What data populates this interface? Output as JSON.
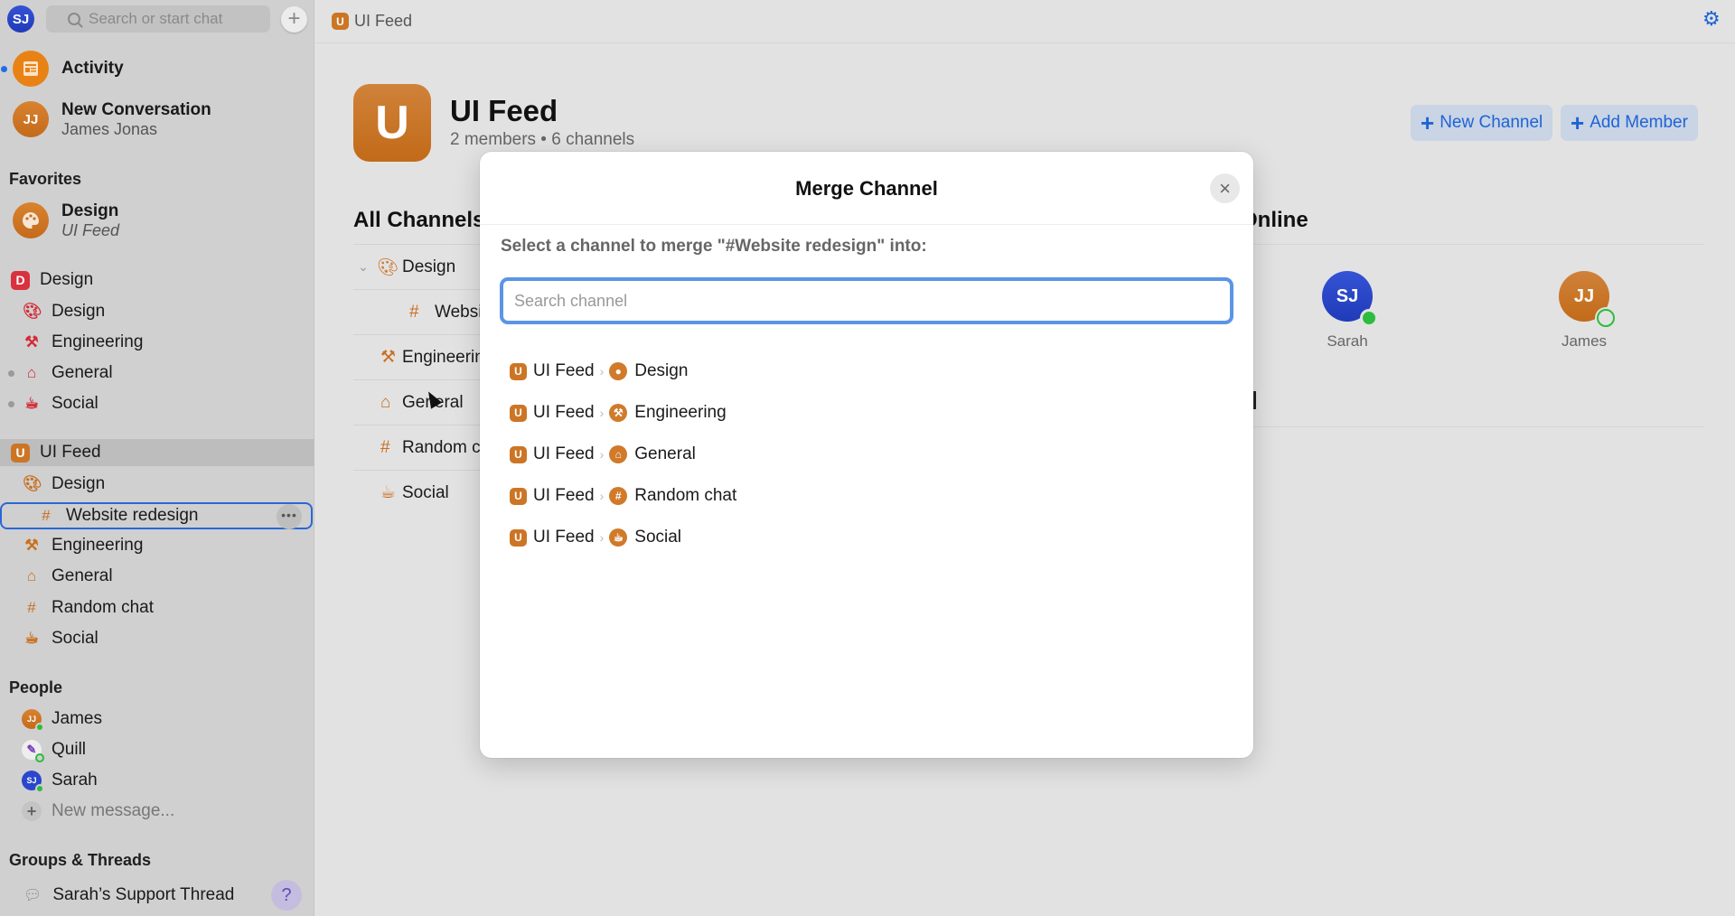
{
  "sidebar": {
    "me_initials": "SJ",
    "search_placeholder": "Search or start chat",
    "new_chat_icon": "plus-icon",
    "activity": {
      "label": "Activity",
      "icon": "newspaper-icon",
      "unread": true
    },
    "conversation": {
      "title": "New Conversation",
      "subtitle": "James Jonas",
      "initials": "JJ"
    },
    "favorites": {
      "heading": "Favorites",
      "items": [
        {
          "title": "Design",
          "subtitle": "UI Feed",
          "icon": "palette-icon"
        }
      ]
    },
    "workspaces": [
      {
        "badge": "D",
        "name": "Design",
        "color": "#d8313f",
        "channels": [
          {
            "label": "Design",
            "icon": "palette-icon",
            "unread": false
          },
          {
            "label": "Engineering",
            "icon": "hammer-icon",
            "unread": false
          },
          {
            "label": "General",
            "icon": "house-icon",
            "unread": true
          },
          {
            "label": "Social",
            "icon": "cup-icon",
            "unread": true
          }
        ]
      },
      {
        "badge": "U",
        "name": "UI Feed",
        "color": "#cc7525",
        "channels": [
          {
            "label": "Design",
            "icon": "palette-icon"
          },
          {
            "label": "Website redesign",
            "icon": "hash-icon",
            "selected": true
          },
          {
            "label": "Engineering",
            "icon": "hammer-icon"
          },
          {
            "label": "General",
            "icon": "house-icon"
          },
          {
            "label": "Random chat",
            "icon": "hash-icon"
          },
          {
            "label": "Social",
            "icon": "cup-icon"
          }
        ]
      }
    ],
    "people": {
      "heading": "People",
      "items": [
        {
          "name": "James",
          "initials": "JJ",
          "status": "online"
        },
        {
          "name": "Quill",
          "initials": "",
          "status": "away"
        },
        {
          "name": "Sarah",
          "initials": "SJ",
          "status": "online"
        }
      ],
      "new_message": "New message..."
    },
    "groups": {
      "heading": "Groups & Threads",
      "items": [
        {
          "name": "Sarah’s Support Thread"
        }
      ]
    },
    "help_label": "?"
  },
  "topbar": {
    "badge": "U",
    "title": "UI Feed"
  },
  "workspace": {
    "badge": "U",
    "title": "UI Feed",
    "subtitle": "2 members • 6 channels",
    "new_channel_label": "New Channel",
    "add_member_label": "Add Member",
    "all_channels_heading": "All Channels",
    "channels": [
      {
        "label": "Design",
        "icon": "palette-icon",
        "expanded": true
      },
      {
        "label": "Website redesign",
        "icon": "hash-icon",
        "child": true
      },
      {
        "label": "Engineering",
        "icon": "hammer-icon"
      },
      {
        "label": "General",
        "icon": "house-icon"
      },
      {
        "label": "Random chat",
        "icon": "hash-icon"
      },
      {
        "label": "Social",
        "icon": "cup-icon"
      }
    ],
    "online_heading": "Online",
    "online_people": [
      {
        "name": "Sarah",
        "initials": "SJ",
        "status": "online",
        "color": "#2a46cc"
      },
      {
        "name": "James",
        "initials": "JJ",
        "status": "away",
        "color": "#c96f20"
      }
    ]
  },
  "modal": {
    "title": "Merge Channel",
    "prompt": "Select a channel to merge \"#Website redesign\" into:",
    "search_placeholder": "Search channel",
    "search_value": "",
    "destinations": [
      {
        "workspace": "UI Feed",
        "channel": "Design",
        "icon": "palette-icon"
      },
      {
        "workspace": "UI Feed",
        "channel": "Engineering",
        "icon": "hammer-icon"
      },
      {
        "workspace": "UI Feed",
        "channel": "General",
        "icon": "house-icon"
      },
      {
        "workspace": "UI Feed",
        "channel": "Random chat",
        "icon": "hash-icon"
      },
      {
        "workspace": "UI Feed",
        "channel": "Social",
        "icon": "cup-icon"
      }
    ]
  },
  "colors": {
    "accent": "#1e63d6",
    "brand_orange": "#cc7525",
    "brand_red": "#d8313f",
    "online": "#2dbc3e"
  }
}
